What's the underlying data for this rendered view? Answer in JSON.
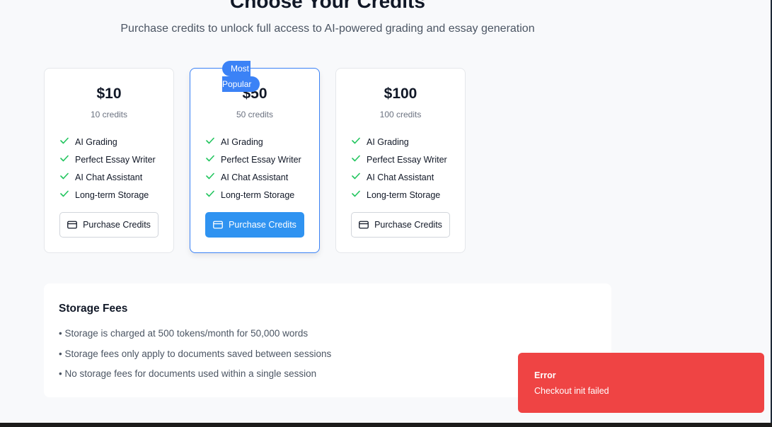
{
  "page": {
    "title": "Choose Your Credits",
    "subtitle": "Purchase credits to unlock full access to AI-powered grading and essay generation"
  },
  "plans": [
    {
      "price": "$10",
      "credits": "10 credits",
      "features": [
        "AI Grading",
        "Perfect Essay Writer",
        "AI Chat Assistant",
        "Long-term Storage"
      ],
      "button_label": "Purchase Credits"
    },
    {
      "price": "$50",
      "credits": "50 credits",
      "badge_line1": "Most",
      "badge_line2": "Popular",
      "features": [
        "AI Grading",
        "Perfect Essay Writer",
        "AI Chat Assistant",
        "Long-term Storage"
      ],
      "button_label": "Purchase Credits"
    },
    {
      "price": "$100",
      "credits": "100 credits",
      "features": [
        "AI Grading",
        "Perfect Essay Writer",
        "AI Chat Assistant",
        "Long-term Storage"
      ],
      "button_label": "Purchase Credits"
    }
  ],
  "storage": {
    "title": "Storage Fees",
    "items": [
      "• Storage is charged at 500 tokens/month for 50,000 words",
      "• Storage fees only apply to documents saved between sessions",
      "• No storage fees for documents used within a single session"
    ]
  },
  "toast": {
    "title": "Error",
    "message": "Checkout init failed"
  },
  "icons": {
    "check": "check-icon",
    "credit_card": "credit-card-icon"
  },
  "colors": {
    "primary": "#2f93f1",
    "badge": "#3b82f6",
    "check": "#22c55e",
    "error": "#ef4444"
  }
}
